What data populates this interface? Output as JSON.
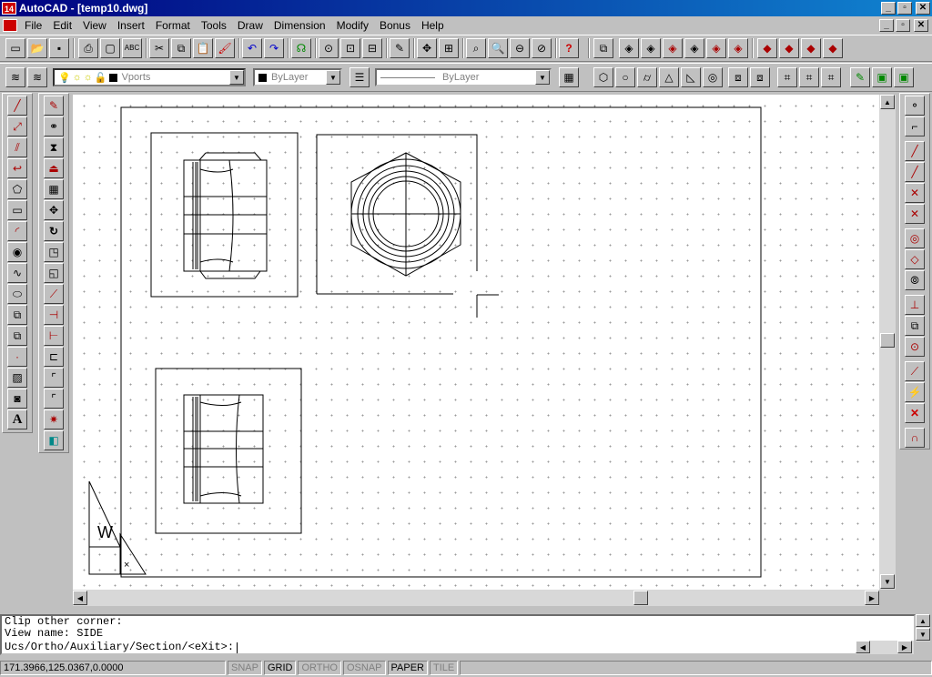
{
  "window": {
    "app_icon": "14",
    "title": "AutoCAD - [temp10.dwg]",
    "controls": [
      "_",
      "▫",
      "✕"
    ],
    "doc_controls": [
      "_",
      "▫",
      "✕"
    ]
  },
  "menu": {
    "items": [
      "File",
      "Edit",
      "View",
      "Insert",
      "Format",
      "Tools",
      "Draw",
      "Dimension",
      "Modify",
      "Bonus",
      "Help"
    ]
  },
  "toolbar_standard": {
    "icons": [
      "new-icon",
      "open-icon",
      "save-icon",
      "print-icon",
      "print-preview-icon",
      "spelling-icon",
      "cut-icon",
      "copy-icon",
      "paste-icon",
      "match-properties-icon",
      "undo-icon",
      "redo-icon",
      "launch-browser-icon",
      "object-snap-icon",
      "snap-from-icon",
      "tracking-icon",
      "ucs-icon",
      "pan-icon",
      "redraw-icon",
      "zoom-realtime-icon",
      "zoom-window-icon",
      "zoom-previous-icon",
      "aerial-view-icon",
      "help-icon",
      "surfaces-icon",
      "box-icon",
      "wedge-icon",
      "cone-icon",
      "sphere-icon",
      "torus-icon",
      "dish-icon",
      "dome-icon",
      "mesh-icon",
      "edge-icon"
    ]
  },
  "toolbar_layers": {
    "layer_name": "Vports",
    "color": "ByLayer",
    "linetype": "ByLayer",
    "icons": [
      "layers-icon",
      "make-layer-current-icon",
      "on-off-icon",
      "freeze-icon",
      "lock-icon",
      "color-swatch-icon",
      "lineweight-icon",
      "properties-icon"
    ],
    "solid_icons": [
      "box-solid-icon",
      "sphere-solid-icon",
      "cylinder-solid-icon",
      "cone-solid-icon",
      "wedge-solid-icon",
      "torus-solid-icon",
      "extrude-icon",
      "revolve-icon",
      "slice-icon",
      "section-icon",
      "interfere-icon",
      "setup-drawing-icon",
      "setup-view-icon",
      "setup-profile-icon"
    ]
  },
  "draw_toolbar": {
    "icons": [
      "line-icon",
      "construction-line-icon",
      "multiline-icon",
      "polyline-icon",
      "polygon-icon",
      "rectangle-icon",
      "arc-icon",
      "circle-icon",
      "spline-icon",
      "ellipse-icon",
      "insert-block-icon",
      "make-block-icon",
      "point-icon",
      "hatch-icon",
      "region-icon",
      "multiline-text-icon"
    ],
    "text_label": "A"
  },
  "modify_toolbar": {
    "icons": [
      "erase-icon",
      "copy-object-icon",
      "mirror-icon",
      "offset-icon",
      "array-icon",
      "move-icon",
      "rotate-icon",
      "scale-icon",
      "stretch-icon",
      "lengthen-icon",
      "trim-icon",
      "extend-icon",
      "break-icon",
      "chamfer-icon",
      "fillet-icon",
      "explode-icon",
      "block-icon"
    ]
  },
  "snap_toolbar": {
    "icons": [
      "tracking-snap-icon",
      "from-snap-icon",
      "endpoint-icon",
      "midpoint-icon",
      "intersection-icon",
      "apparent-intersection-icon",
      "center-icon",
      "quadrant-icon",
      "tangent-icon",
      "perpendicular-icon",
      "insertion-icon",
      "node-icon",
      "nearest-icon",
      "quick-snap-icon",
      "none-snap-icon",
      "snap-settings-icon"
    ]
  },
  "command_line": {
    "history": [
      "Clip other corner:",
      "View name: SIDE"
    ],
    "prompt": "Ucs/Ortho/Auxiliary/Section/<eXit>: "
  },
  "status_bar": {
    "coordinates": "171.3966,125.0367,0.0000",
    "toggles": [
      {
        "label": "SNAP",
        "on": false
      },
      {
        "label": "GRID",
        "on": true
      },
      {
        "label": "ORTHO",
        "on": false
      },
      {
        "label": "OSNAP",
        "on": false
      },
      {
        "label": "PAPER",
        "on": true
      },
      {
        "label": "TILE",
        "on": false
      }
    ]
  },
  "ucs_icon": {
    "label": "W"
  }
}
